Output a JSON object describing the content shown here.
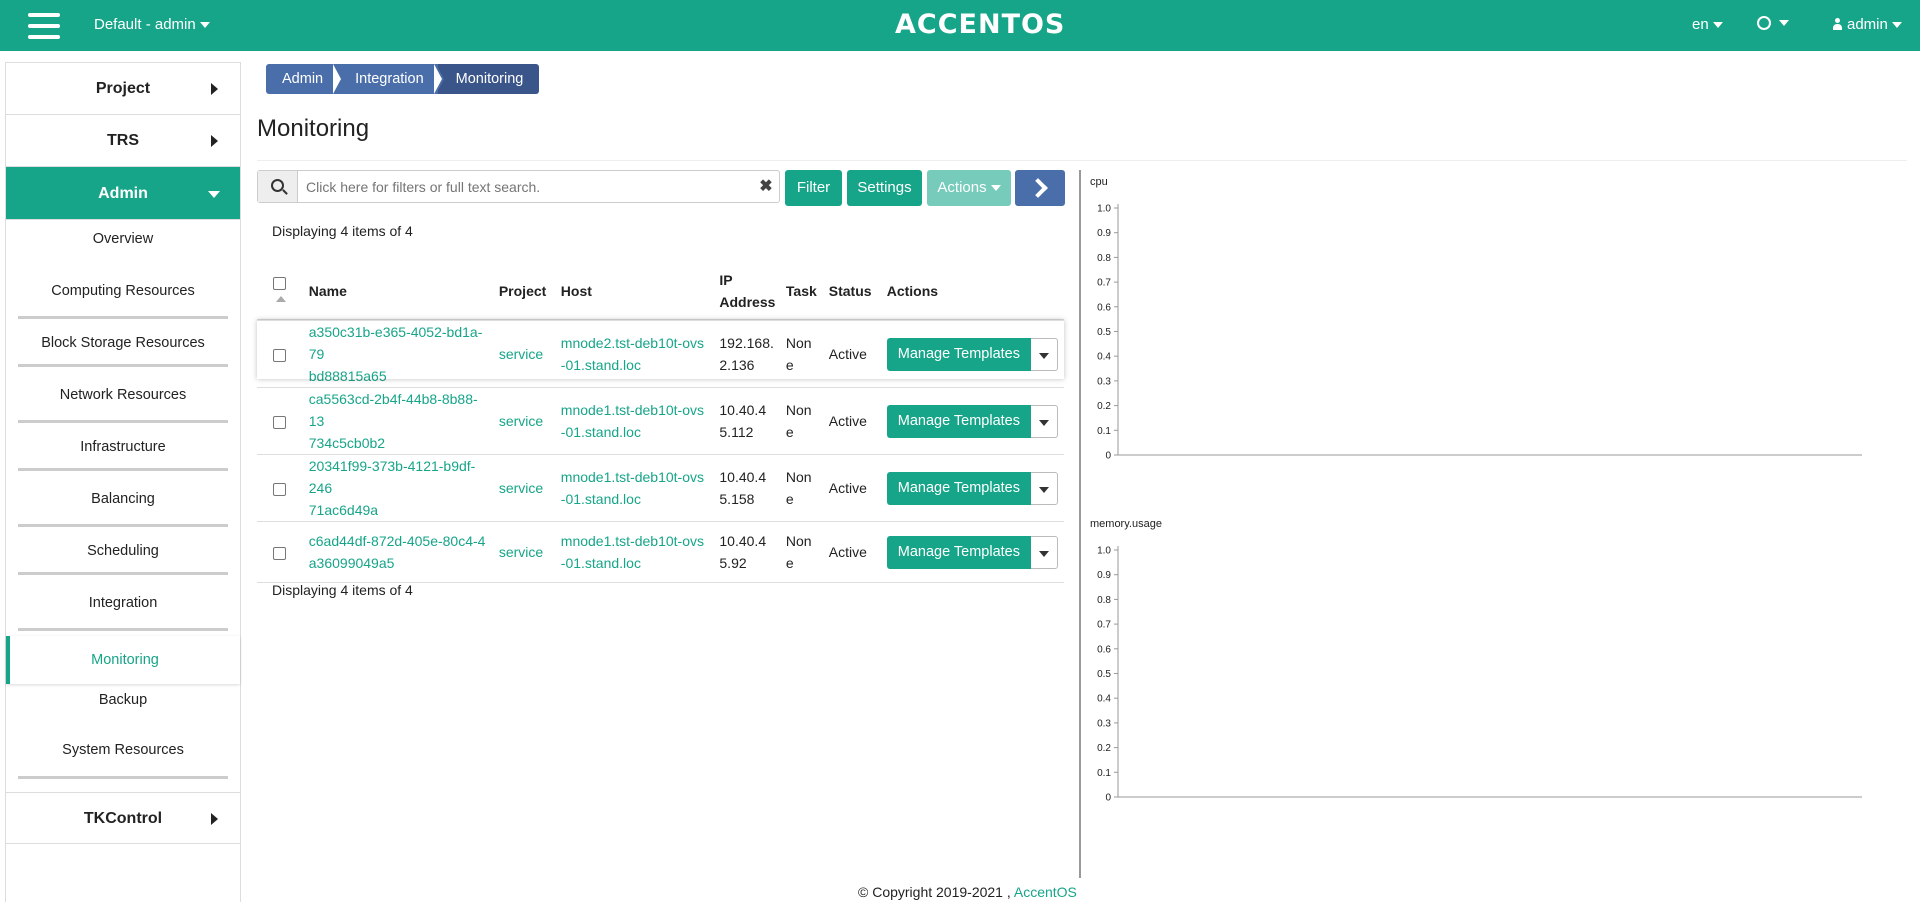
{
  "topbar": {
    "project_select": "Default - admin",
    "logo": "ACCENTOS",
    "lang": "en",
    "user": "admin"
  },
  "sidebar": {
    "sections": [
      {
        "label": "Project"
      },
      {
        "label": "TRS"
      },
      {
        "label": "Admin"
      }
    ],
    "admin_items": [
      "Overview",
      "Computing Resources",
      "Block Storage Resources",
      "Network Resources",
      "Infrastructure",
      "Balancing",
      "Scheduling",
      "Integration",
      "Monitoring",
      "Backup",
      "System Resources"
    ],
    "bottom_sections": [
      {
        "label": "TKControl"
      }
    ]
  },
  "breadcrumb": [
    "Admin",
    "Integration",
    "Monitoring"
  ],
  "page_title": "Monitoring",
  "search": {
    "placeholder": "Click here for filters or full text search."
  },
  "buttons": {
    "filter": "Filter",
    "settings": "Settings",
    "actions": "Actions"
  },
  "displaying": "Displaying 4 items of 4",
  "table": {
    "columns": [
      "Name",
      "Project",
      "Host",
      "IP Address",
      "Task",
      "Status",
      "Actions"
    ],
    "rows": [
      {
        "name": [
          "a350c31b-e365-4052-bd1a-79",
          "bd88815a65"
        ],
        "project": "service",
        "host": [
          "mnode2.tst-deb10t-ovs",
          "-01.stand.loc"
        ],
        "ip": [
          "192.168.",
          "2.136"
        ],
        "task": [
          "Non",
          "e"
        ],
        "status": "Active",
        "action": "Manage Templates"
      },
      {
        "name": [
          "ca5563cd-2b4f-44b8-8b88-13",
          "734c5cb0b2"
        ],
        "project": "service",
        "host": [
          "mnode1.tst-deb10t-ovs",
          "-01.stand.loc"
        ],
        "ip": [
          "10.40.4",
          "5.112"
        ],
        "task": [
          "Non",
          "e"
        ],
        "status": "Active",
        "action": "Manage Templates"
      },
      {
        "name": [
          "20341f99-373b-4121-b9df-246",
          "71ac6d49a"
        ],
        "project": "service",
        "host": [
          "mnode1.tst-deb10t-ovs",
          "-01.stand.loc"
        ],
        "ip": [
          "10.40.4",
          "5.158"
        ],
        "task": [
          "Non",
          "e"
        ],
        "status": "Active",
        "action": "Manage Templates"
      },
      {
        "name": [
          "c6ad44df-872d-405e-80c4-4",
          "a36099049a5"
        ],
        "project": "service",
        "host": [
          "mnode1.tst-deb10t-ovs",
          "-01.stand.loc"
        ],
        "ip": [
          "10.40.4",
          "5.92"
        ],
        "task": [
          "Non",
          "e"
        ],
        "status": "Active",
        "action": "Manage Templates"
      }
    ]
  },
  "chart_data": [
    {
      "type": "line",
      "title": "cpu",
      "ylim": [
        0,
        1.0
      ],
      "yticks": [
        "1.0",
        "0.9",
        "0.8",
        "0.7",
        "0.6",
        "0.5",
        "0.4",
        "0.3",
        "0.2",
        "0.1",
        "0"
      ],
      "series": []
    },
    {
      "type": "line",
      "title": "memory.usage",
      "ylim": [
        0,
        1.0
      ],
      "yticks": [
        "1.0",
        "0.9",
        "0.8",
        "0.7",
        "0.6",
        "0.5",
        "0.4",
        "0.3",
        "0.2",
        "0.1",
        "0"
      ],
      "series": []
    }
  ],
  "copyright": {
    "text": "© Copyright 2019-2021 , ",
    "link": "AccentOS"
  },
  "colors": {
    "accent": "#17a589",
    "blue": "#4a6ea9",
    "blue_dark": "#3a5589"
  }
}
